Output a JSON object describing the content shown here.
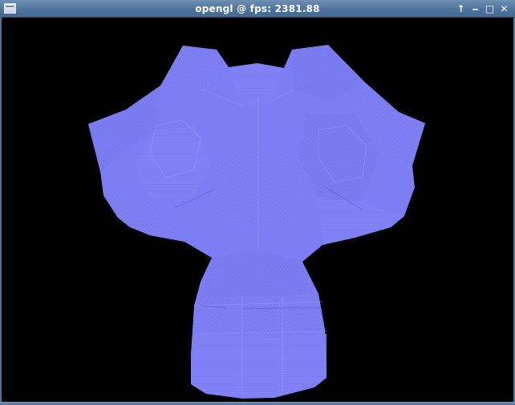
{
  "window": {
    "title": "opengl @ fps: 2381.88",
    "controls": {
      "shade_icon": "↑",
      "minimize_icon": "‒",
      "maximize_icon": "□",
      "close_icon": "✕"
    }
  },
  "viewport": {
    "background": "#000000",
    "mesh_color": "#7f7ff5",
    "mesh_line_color": "#8a8aff",
    "object": "normal-mapped monkey head mesh"
  }
}
